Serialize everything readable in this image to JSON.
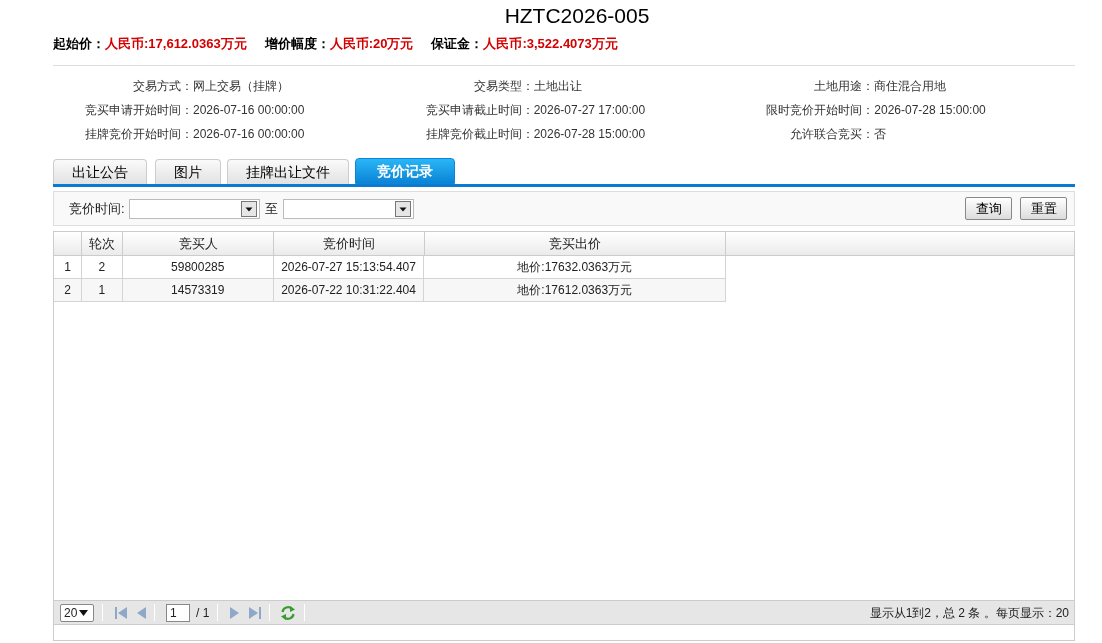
{
  "title": "HZTC2026-005",
  "summary": [
    {
      "label": "起始价：",
      "value": "人民币:17,612.0363万元"
    },
    {
      "label": "增价幅度：",
      "value": "人民币:20万元"
    },
    {
      "label": "保证金：",
      "value": "人民币:3,522.4073万元"
    }
  ],
  "details": [
    {
      "label": "交易方式：",
      "value": "网上交易（挂牌）"
    },
    {
      "label": "交易类型：",
      "value": "土地出让"
    },
    {
      "label": "土地用途：",
      "value": "商住混合用地"
    },
    {
      "label": "竞买申请开始时间：",
      "value": "2026-07-16 00:00:00"
    },
    {
      "label": "竞买申请截止时间：",
      "value": "2026-07-27 17:00:00"
    },
    {
      "label": "限时竞价开始时间：",
      "value": "2026-07-28 15:00:00"
    },
    {
      "label": "挂牌竞价开始时间：",
      "value": "2026-07-16 00:00:00"
    },
    {
      "label": "挂牌竞价截止时间：",
      "value": "2026-07-28 15:00:00"
    },
    {
      "label": "允许联合竞买：",
      "value": "否"
    }
  ],
  "tabs": [
    {
      "label": "出让公告",
      "selected": false
    },
    {
      "label": "图片",
      "selected": false
    },
    {
      "label": "挂牌出让文件",
      "selected": false
    },
    {
      "label": "竞价记录",
      "selected": true
    }
  ],
  "filter": {
    "label": "竞价时间:",
    "separator": "至",
    "buttons": [
      "查询",
      "重置"
    ]
  },
  "table": {
    "columns": [
      "轮次",
      "竞买人",
      "竞价时间",
      "竞买出价"
    ],
    "rows": [
      {
        "number": "1",
        "cells": [
          "2",
          "59800285",
          "2026-07-27 15:13:54.407",
          "地价:17632.0363万元"
        ]
      },
      {
        "number": "2",
        "cells": [
          "1",
          "14573319",
          "2026-07-22 10:31:22.404",
          "地价:17612.0363万元"
        ]
      }
    ]
  },
  "pager": {
    "page_size": "20",
    "page": "1",
    "page_count": "/ 1",
    "summary": "显示从1到2，总 2 条 。每页显示：20"
  }
}
